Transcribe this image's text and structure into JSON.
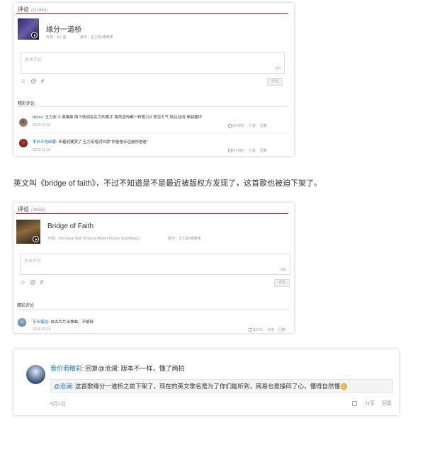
{
  "card1": {
    "heading": "评论",
    "count": "(111663)",
    "song_title": "缘分一道桥",
    "album": "专辑：A.I. 篮",
    "singer": "歌手：王力宏/谭维维",
    "placeholder": "发表评论",
    "char_count": "140",
    "tools": "☺ @ #",
    "submit": "评论",
    "section": "精彩评论",
    "comments": [
      {
        "user": "disois:",
        "text": "王力宏 X 谭维维 两个低调有实力的歌手 虽然宣传都一样差233 苍凉大气 恢弘壮阔 单曲循环",
        "date": "2016-11-15",
        "likes": "(34102)",
        "share": "分享",
        "reply": "回复"
      },
      {
        "user": "李白不吃麻薯:",
        "text": "听着就要哭了 王力宏唱对白那“你爸爸永远是你爸爸”",
        "date": "2016-11-16",
        "likes": "(47145)",
        "share": "分享",
        "reply": "回复"
      }
    ]
  },
  "caption": "英文叫《bridge of faith》，不过不知道是不是最近被版权方发现了，这首歌也被迫下架了。",
  "card2": {
    "heading": "评论",
    "count": "(38555)",
    "song_title": "Bridge of Faith",
    "album": "专辑：The Great Wall (Original Motion Picture Soundtrack)",
    "singer": "歌手：王力宏/谭维维",
    "placeholder": "发表评论",
    "char_count": "140",
    "tools": "☺ @ #",
    "submit": "评论",
    "section": "精彩评论",
    "comments": [
      {
        "user": "芋头蛋挞:",
        "text": "自古烂片出神曲。不解释",
        "date": "2016-02-14",
        "likes": "(1671)",
        "share": "分享",
        "reply": "回复"
      }
    ]
  },
  "card3": {
    "user": "音价而精彩:",
    "text": "回复@沧澜: 版本不一样，懂了两拍",
    "quote_user": "@沧澜:",
    "quote_text": "这首歌缘分一道桥之前下架了，现在的英文歌名是为了你们能听到，网易也是操碎了心，懂得自然懂",
    "date": "9月1日",
    "share": "分享",
    "reply": "回复"
  },
  "colors": {
    "accent": "#c20c0c",
    "link": "#0c73c2"
  }
}
